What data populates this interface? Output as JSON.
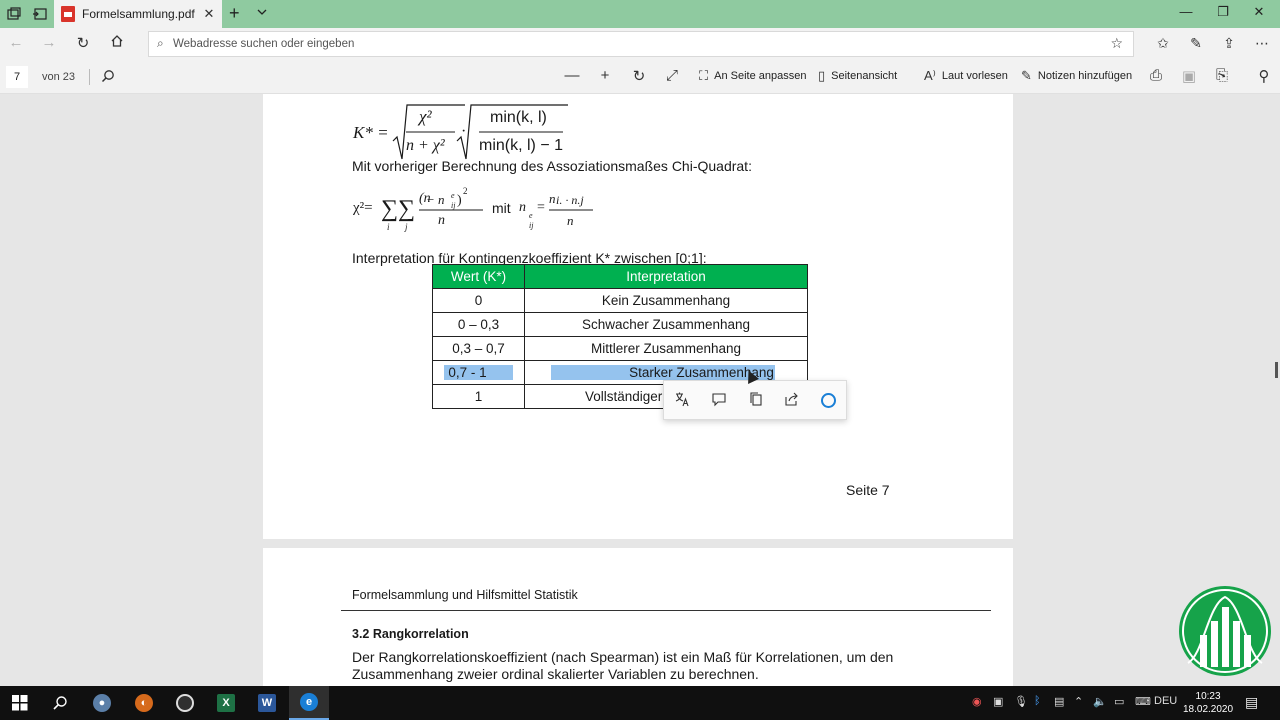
{
  "browser": {
    "tab_title": "Formelsammlung.pdf",
    "address_placeholder": "Webadresse suchen oder eingeben"
  },
  "pdf_toolbar": {
    "current_page": "7",
    "total_pages": "von 23",
    "fit_page": "An Seite anpassen",
    "page_view": "Seitenansicht",
    "read_aloud": "Laut vorlesen",
    "add_notes": "Notizen hinzufügen"
  },
  "page7": {
    "formula1": {
      "lhs": "K* =",
      "chi2": "χ²",
      "n_plus_chi2": "n + χ²",
      "min_num": "min(k, l)",
      "min_den": "min(k, l) − 1"
    },
    "chi_intro": "Mit vorheriger Berechnung des Assoziationsmaßes Chi-Quadrat:",
    "formula2": {
      "lhs": "χ²=",
      "sub_i": "i",
      "sub_j": "j",
      "numerator": "(n",
      "denominator": "n",
      "mit": "mit",
      "frac_num": "n",
      "frac_den": "n"
    },
    "interpretation_intro": "Interpretation für Kontingenzkoeffizient K* zwischen [0;1]:",
    "table": {
      "headers": [
        "Wert (K*)",
        "Interpretation"
      ],
      "rows": [
        [
          "0",
          "Kein Zusammenhang"
        ],
        [
          "0 – 0,3",
          "Schwacher Zusammenhang"
        ],
        [
          "0,3 – 0,7",
          "Mittlerer Zusammenhang"
        ],
        [
          "0,7 - 1",
          "Starker Zusammenhang"
        ],
        [
          "1",
          "Vollständiger"
        ]
      ]
    },
    "page_label": "Seite 7"
  },
  "page8": {
    "header": "Formelsammlung und Hilfsmittel Statistik",
    "heading": "3.2 Rangkorrelation",
    "line1": "Der Rangkorrelationskoeffizient (nach Spearman) ist ein Maß für Korrelationen, um den",
    "line2": "Zusammenhang zweier ordinal skalierter Variablen zu berechnen."
  },
  "taskbar": {
    "language": "DEU",
    "time": "10:23",
    "date": "18.02.2020"
  },
  "icons": {
    "context_menu": [
      "translate-icon",
      "comment-icon",
      "copy-icon",
      "share-icon",
      "cortana-icon"
    ]
  },
  "colors": {
    "table_header": "#00b050",
    "selection": "#95c3ee",
    "tabbar": "#8fcaa0"
  }
}
